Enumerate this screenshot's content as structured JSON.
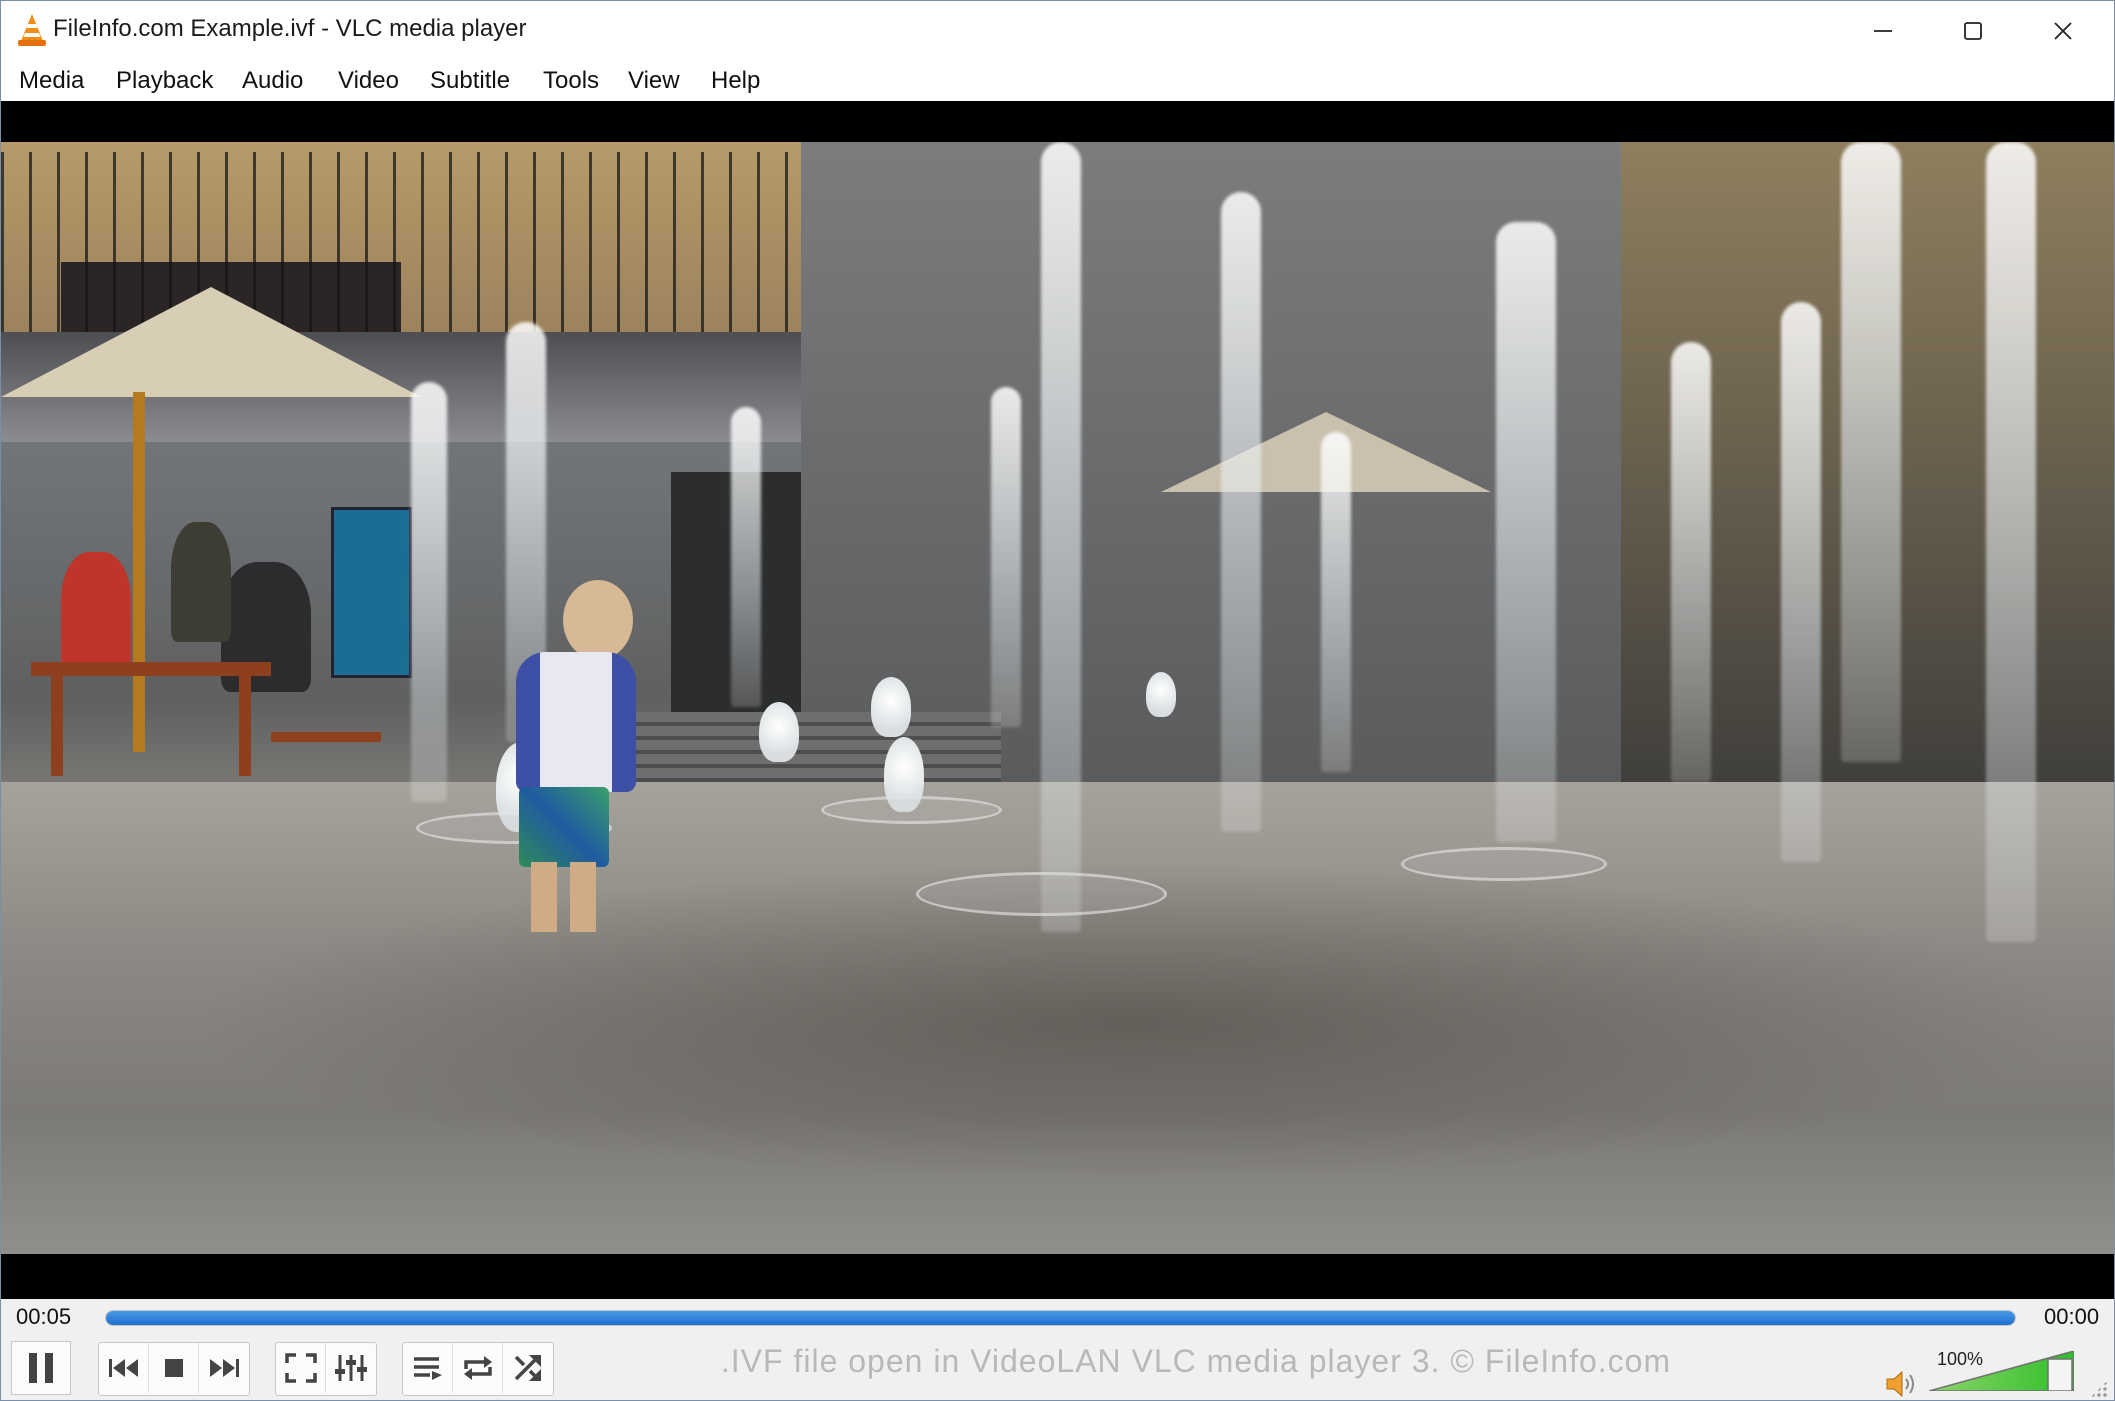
{
  "window": {
    "title": "FileInfo.com Example.ivf - VLC media player",
    "icons": {
      "app": "vlc-cone-icon",
      "minimize": "minimize-icon",
      "maximize": "maximize-icon",
      "close": "close-icon"
    }
  },
  "menu": {
    "items": [
      {
        "label": "Media"
      },
      {
        "label": "Playback"
      },
      {
        "label": "Audio"
      },
      {
        "label": "Video"
      },
      {
        "label": "Subtitle"
      },
      {
        "label": "Tools"
      },
      {
        "label": "View"
      },
      {
        "label": "Help"
      }
    ]
  },
  "video": {
    "description_icon": "video-frame"
  },
  "player": {
    "elapsed": "00:05",
    "remaining": "00:00",
    "progress": 1.0,
    "status_text": ".IVF file open in VideoLAN VLC media player 3. © FileInfo.com",
    "volume_label": "100%",
    "volume": 1.0,
    "buttons": [
      {
        "name": "pause-button",
        "icon": "pause-icon"
      },
      {
        "name": "previous-button",
        "icon": "skip-previous-icon"
      },
      {
        "name": "stop-button",
        "icon": "stop-icon"
      },
      {
        "name": "next-button",
        "icon": "skip-next-icon"
      },
      {
        "name": "fullscreen-button",
        "icon": "fullscreen-icon"
      },
      {
        "name": "extended-settings-button",
        "icon": "equalizer-icon"
      },
      {
        "name": "playlist-button",
        "icon": "playlist-icon"
      },
      {
        "name": "loop-button",
        "icon": "loop-icon"
      },
      {
        "name": "shuffle-button",
        "icon": "shuffle-icon"
      }
    ],
    "colors": {
      "seek_fill": "#1f6fcf",
      "volume_fill": "#2fbf2a"
    }
  }
}
